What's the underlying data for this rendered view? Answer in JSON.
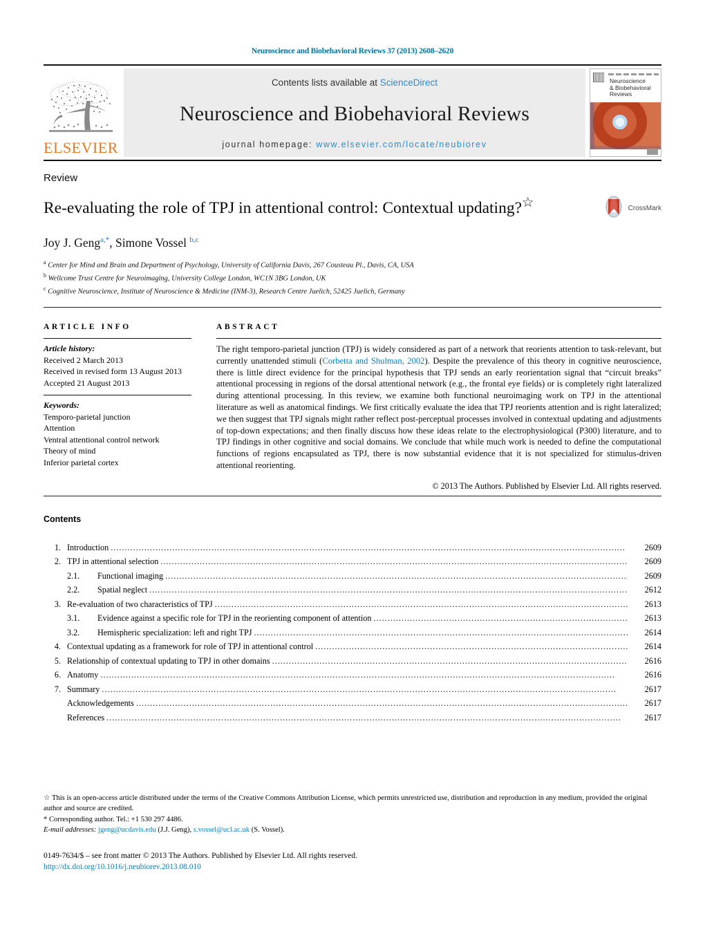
{
  "running_head": "Neuroscience and Biobehavioral Reviews 37 (2013) 2608–2620",
  "masthead": {
    "publisher_name": "ELSEVIER",
    "contents_prefix": "Contents lists available at ",
    "sciencedirect": "ScienceDirect",
    "journal_title": "Neuroscience and Biobehavioral Reviews",
    "homepage_prefix": "journal homepage: ",
    "homepage_url": "www.elsevier.com/locate/neubiorev",
    "cover_journal_name": "Neuroscience\n& Biobehavioral\nReviews"
  },
  "article": {
    "kind": "Review",
    "title": "Re-evaluating the role of TPJ in attentional control: Contextual updating?",
    "title_marker": "☆",
    "crossmark_label": "CrossMark",
    "authors_plain": "Joy J. Geng, Simone Vossel",
    "author1": "Joy J. Geng",
    "author1_sup": "a,*",
    "author2": "Simone Vossel",
    "author2_sup": "b,c",
    "affiliations": [
      {
        "marker": "a",
        "text": "Center for Mind and Brain and Department of Psychology, University of California Davis, 267 Cousteau Pl., Davis, CA, USA"
      },
      {
        "marker": "b",
        "text": "Wellcome Trust Centre for Neuroimaging, University College London, WC1N 3BG London, UK"
      },
      {
        "marker": "c",
        "text": "Cognitive Neuroscience, Institute of Neuroscience & Medicine (INM-3), Research Centre Juelich, 52425 Juelich, Germany"
      }
    ]
  },
  "article_info": {
    "heading": "ARTICLE INFO",
    "history_label": "Article history:",
    "history": [
      "Received 2 March 2013",
      "Received in revised form 13 August 2013",
      "Accepted 21 August 2013"
    ],
    "keywords_label": "Keywords:",
    "keywords": [
      "Temporo-parietal junction",
      "Attention",
      "Ventral attentional control network",
      "Theory of mind",
      "Inferior parietal cortex"
    ]
  },
  "abstract": {
    "heading": "ABSTRACT",
    "part1": "The right temporo-parietal junction (TPJ) is widely considered as part of a network that reorients attention to task-relevant, but currently unattended stimuli (",
    "citation": "Corbetta and Shulman, 2002",
    "part2": "). Despite the prevalence of this theory in cognitive neuroscience, there is little direct evidence for the principal hypothesis that TPJ sends an early reorientation signal that “circuit breaks” attentional processing in regions of the dorsal attentional network (e.g., the frontal eye fields) or is completely right lateralized during attentional processing. In this review, we examine both functional neuroimaging work on TPJ in the attentional literature as well as anatomical findings. We first critically evaluate the idea that TPJ reorients attention and is right lateralized; we then suggest that TPJ signals might rather reflect post-perceptual processes involved in contextual updating and adjustments of top-down expectations; and then finally discuss how these ideas relate to the electrophysiological (P300) literature, and to TPJ findings in other cognitive and social domains. We conclude that while much work is needed to define the computational functions of regions encapsulated as TPJ, there is now substantial evidence that it is not specialized for stimulus-driven attentional reorienting.",
    "copyright": "© 2013 The Authors. Published by Elsevier Ltd. All rights reserved."
  },
  "contents": {
    "heading": "Contents",
    "entries": [
      {
        "num": "1.",
        "sub": "",
        "label": "Introduction",
        "page": "2609",
        "level": 1
      },
      {
        "num": "2.",
        "sub": "",
        "label": "TPJ in attentional selection",
        "page": "2609",
        "level": 1
      },
      {
        "num": "",
        "sub": "2.1.",
        "label": "Functional imaging",
        "page": "2609",
        "level": 2
      },
      {
        "num": "",
        "sub": "2.2.",
        "label": "Spatial neglect",
        "page": "2612",
        "level": 2
      },
      {
        "num": "3.",
        "sub": "",
        "label": "Re-evaluation of two characteristics of TPJ",
        "page": "2613",
        "level": 1
      },
      {
        "num": "",
        "sub": "3.1.",
        "label": "Evidence against a specific role for TPJ in the reorienting component of attention",
        "page": "2613",
        "level": 2
      },
      {
        "num": "",
        "sub": "3.2.",
        "label": "Hemispheric specialization: left and right TPJ",
        "page": "2614",
        "level": 2
      },
      {
        "num": "4.",
        "sub": "",
        "label": "Contextual updating as a framework for role of TPJ in attentional control",
        "page": "2614",
        "level": 1
      },
      {
        "num": "5.",
        "sub": "",
        "label": "Relationship of contextual updating to TPJ in other domains",
        "page": "2616",
        "level": 1
      },
      {
        "num": "6.",
        "sub": "",
        "label": "Anatomy",
        "page": "2616",
        "level": 1
      },
      {
        "num": "7.",
        "sub": "",
        "label": "Summary",
        "page": "2617",
        "level": 1
      },
      {
        "num": "",
        "sub": "",
        "label": "Acknowledgements",
        "page": "2617",
        "level": 3
      },
      {
        "num": "",
        "sub": "",
        "label": "References",
        "page": "2617",
        "level": 3
      }
    ]
  },
  "footnotes": {
    "star_marker": "☆",
    "open_access": "This is an open-access article distributed under the terms of the Creative Commons Attribution License, which permits unrestricted use, distribution and reproduction in any medium, provided the original author and source are credited.",
    "corresponding_marker": "*",
    "corresponding": "Corresponding author. Tel.: +1 530 297 4486.",
    "email_label": "E-mail addresses:",
    "email1": "jgeng@ucdavis.edu",
    "email1_owner": "(J.J. Geng),",
    "email2": "s.vossel@ucl.ac.uk",
    "email2_owner": "(S. Vossel).",
    "frontmatter": "0149-7634/$ – see front matter © 2013 The Authors. Published by Elsevier Ltd. All rights reserved.",
    "doi": "http://dx.doi.org/10.1016/j.neubiorev.2013.08.010"
  },
  "colors": {
    "journal_header": "#00739c",
    "link_blue": "#2e8cc7",
    "ref_blue": "#0d7cb5",
    "elsevier_orange": "#E87722",
    "masthead_bg": "#ececec"
  }
}
